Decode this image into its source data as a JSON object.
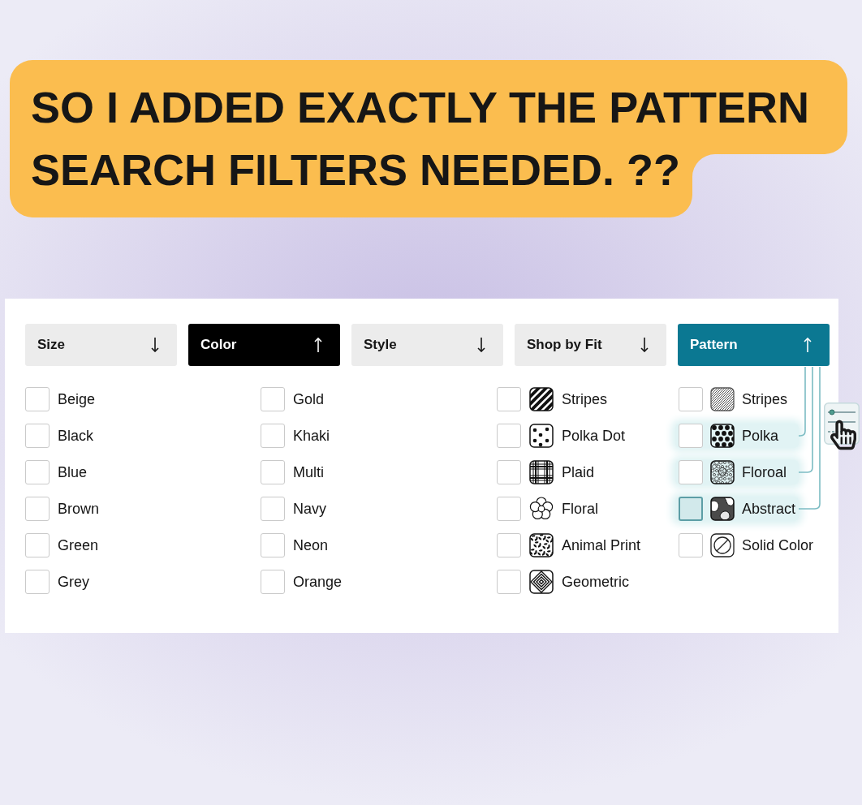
{
  "headline": "SO I ADDED EXACTLY THE PATTERN SEARCH FILTERS NEEDED. ??",
  "filter_tabs": [
    {
      "label": "Size",
      "expanded": false,
      "selected": false,
      "highlighted": false
    },
    {
      "label": "Color",
      "expanded": true,
      "selected": true,
      "highlighted": false
    },
    {
      "label": "Style",
      "expanded": false,
      "selected": false,
      "highlighted": false
    },
    {
      "label": "Shop by Fit",
      "expanded": false,
      "selected": false,
      "highlighted": false
    },
    {
      "label": "Pattern",
      "expanded": true,
      "selected": true,
      "highlighted": true
    }
  ],
  "option_columns": [
    {
      "kind": "text",
      "options": [
        {
          "label": "Beige",
          "checked": false
        },
        {
          "label": "Black",
          "checked": false
        },
        {
          "label": "Blue",
          "checked": false
        },
        {
          "label": "Brown",
          "checked": false
        },
        {
          "label": "Green",
          "checked": false
        },
        {
          "label": "Grey",
          "checked": false
        }
      ]
    },
    {
      "kind": "text",
      "options": [
        {
          "label": "Gold",
          "checked": false
        },
        {
          "label": "Khaki",
          "checked": false
        },
        {
          "label": "Multi",
          "checked": false
        },
        {
          "label": "Navy",
          "checked": false
        },
        {
          "label": "Neon",
          "checked": false
        },
        {
          "label": "Orange",
          "checked": false
        }
      ]
    },
    {
      "kind": "icon",
      "options": [
        {
          "label": "Stripes",
          "checked": false
        },
        {
          "label": "Polka Dot",
          "checked": false
        },
        {
          "label": "Plaid",
          "checked": false
        },
        {
          "label": "Floral",
          "checked": false
        },
        {
          "label": "Animal Print",
          "checked": false
        },
        {
          "label": "Geometric",
          "checked": false
        }
      ]
    },
    {
      "kind": "icon",
      "options": [
        {
          "label": "Stripes",
          "checked": false,
          "highlighted": false,
          "focused": false
        },
        {
          "label": "Polka",
          "checked": false,
          "highlighted": true,
          "focused": false
        },
        {
          "label": "Floroal",
          "checked": false,
          "highlighted": true,
          "focused": false
        },
        {
          "label": "Abstract",
          "checked": false,
          "highlighted": true,
          "focused": true
        },
        {
          "label": "Solid Color",
          "checked": false,
          "highlighted": false,
          "focused": false
        }
      ]
    }
  ]
}
